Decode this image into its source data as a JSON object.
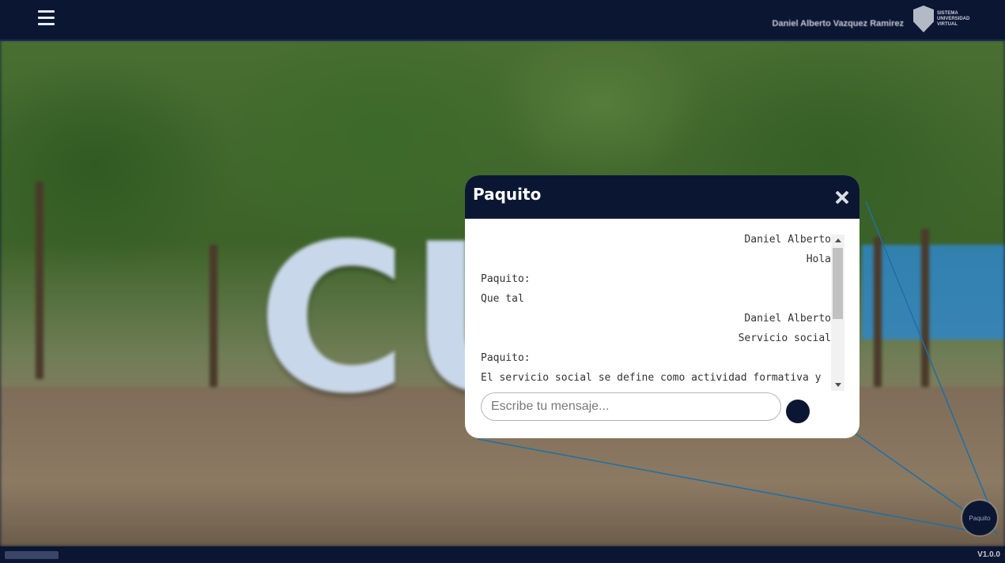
{
  "header": {
    "menu_icon": "hamburger-icon",
    "user_name": "Daniel Alberto Vazquez Ramirez",
    "logo_text": "SISTEMA\nUNIVERSIDAD\nVIRTUAL"
  },
  "chat": {
    "title": "Paquito",
    "close_icon": "close-icon",
    "messages": [
      {
        "sender": "user",
        "name": "Daniel Alberto",
        "text": "Hola"
      },
      {
        "sender": "bot",
        "name": "Paquito:",
        "text": "Que tal"
      },
      {
        "sender": "user",
        "name": "Daniel Alberto",
        "text": "Servicio social"
      },
      {
        "sender": "bot",
        "name": "Paquito:",
        "text": "El servicio social se define como actividad formativa y"
      }
    ],
    "input_placeholder": "Escribe tu mensaje...",
    "send_icon": "send-icon"
  },
  "launcher": {
    "label": "Paquito"
  },
  "footer": {
    "version": "V1.0.0"
  },
  "colors": {
    "navy": "#0b1633",
    "accent_line": "#1e6fa8"
  }
}
